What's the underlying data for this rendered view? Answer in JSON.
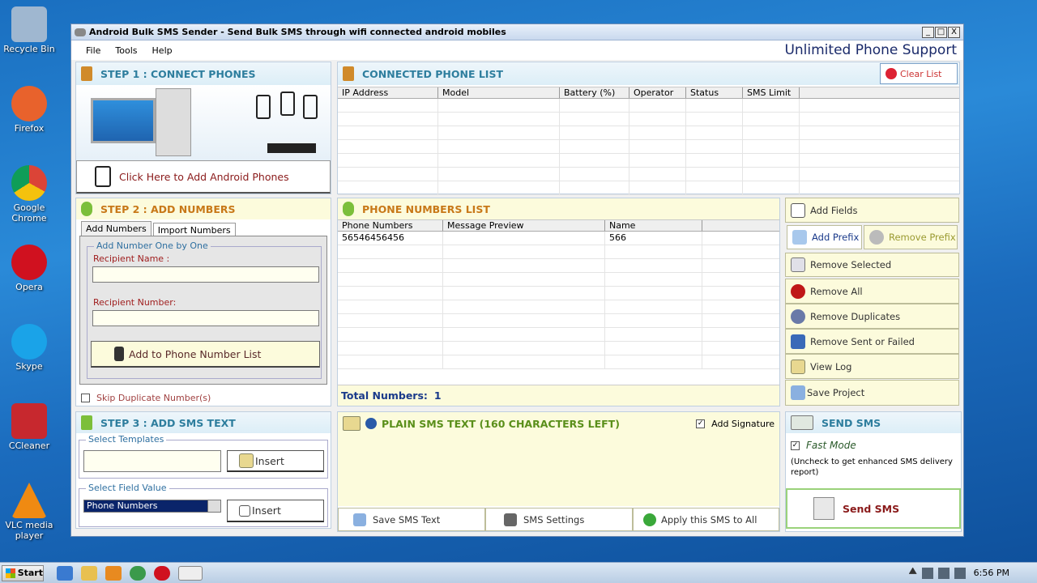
{
  "desktop": {
    "icons": [
      {
        "label": "Recycle Bin",
        "color": "#9fb7d0"
      },
      {
        "label": "Firefox",
        "color": "#e8622c"
      },
      {
        "label": "Google Chrome",
        "color": "#3b9a4b"
      },
      {
        "label": "Opera",
        "color": "#d0111f"
      },
      {
        "label": "Skype",
        "color": "#1aa3e8"
      },
      {
        "label": "CCleaner",
        "color": "#c7282e"
      },
      {
        "label": "VLC media player",
        "color": "#f08a12"
      }
    ]
  },
  "window": {
    "title": "Android Bulk SMS Sender - Send Bulk SMS through wifi connected android mobiles",
    "controls": {
      "minimize": "_",
      "maximize": "□",
      "close": "X"
    },
    "menu": [
      "File",
      "Tools",
      "Help"
    ],
    "support_label": "Unlimited Phone Support"
  },
  "step1": {
    "title": "STEP 1 : CONNECT PHONES",
    "add_phones_label": "Click Here to Add Android Phones"
  },
  "connected": {
    "title": "CONNECTED PHONE LIST",
    "clear_label": "Clear List",
    "columns": [
      "IP Address",
      "Model",
      "Battery (%)",
      "Operator",
      "Status",
      "SMS Limit"
    ]
  },
  "step2": {
    "title": "STEP 2 : ADD NUMBERS",
    "tabs": [
      "Add Numbers",
      "Import Numbers"
    ],
    "group_label": "Add Number One by One",
    "recipient_name_label": "Recipient Name :",
    "recipient_number_label": "Recipient Number:",
    "add_button": "Add to Phone Number List",
    "skip_duplicates": "Skip Duplicate Number(s)"
  },
  "numbers": {
    "title": "PHONE NUMBERS LIST",
    "columns": [
      "Phone Numbers",
      "Message Preview",
      "Name"
    ],
    "rows": [
      [
        "56546456456",
        "",
        "566"
      ]
    ],
    "total_label": "Total Numbers:",
    "total_value": "1"
  },
  "actions": {
    "add_fields": "Add Fields",
    "add_prefix": "Add Prefix",
    "remove_prefix": "Remove Prefix",
    "remove_selected": "Remove Selected",
    "remove_all": "Remove All",
    "remove_duplicates": "Remove Duplicates",
    "remove_sent_failed": "Remove Sent or Failed",
    "view_log": "View Log",
    "save_project": "Save Project"
  },
  "step3": {
    "title": "STEP 3 : ADD SMS TEXT",
    "templates_label": "Select Templates",
    "insert_label": "Insert",
    "field_label": "Select Field Value",
    "field_value": "Phone Numbers"
  },
  "sms": {
    "title": "PLAIN SMS TEXT (160 CHARACTERS LEFT)",
    "signature_label": "Add Signature",
    "save_text": "Save SMS Text",
    "settings": "SMS Settings",
    "apply_all": "Apply this SMS to All"
  },
  "send": {
    "title": "SEND SMS",
    "fast_mode": "Fast Mode",
    "note": "(Uncheck to get enhanced SMS delivery report)",
    "send_button": "Send SMS"
  },
  "taskbar": {
    "start": "Start",
    "clock": "6:56 PM"
  }
}
